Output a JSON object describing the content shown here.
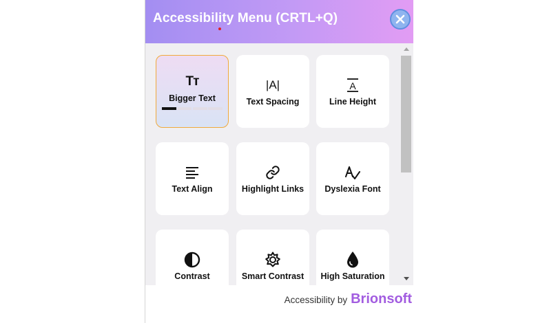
{
  "header": {
    "title": "Accessibility Menu (CRTL+Q)",
    "close_icon": "close-icon",
    "gradient_colors": [
      "#a38ef2",
      "#e29cf4"
    ]
  },
  "cards": [
    {
      "label": "Bigger Text",
      "icon": "text-size-icon",
      "icon_text": "Tт",
      "active": true,
      "level": 1,
      "levels": 4
    },
    {
      "label": "Text Spacing",
      "icon": "text-spacing-icon",
      "icon_text": "|A|"
    },
    {
      "label": "Line Height",
      "icon": "line-height-icon"
    },
    {
      "label": "Text Align",
      "icon": "text-align-icon"
    },
    {
      "label": "Highlight Links",
      "icon": "link-icon"
    },
    {
      "label": "Dyslexia Font",
      "icon": "dyslexia-font-icon"
    },
    {
      "label": "Contrast",
      "icon": "contrast-icon"
    },
    {
      "label": "Smart Contrast",
      "icon": "smart-contrast-icon"
    },
    {
      "label": "High Saturation",
      "icon": "saturation-drop-icon"
    }
  ],
  "footer": {
    "prefix": "Accessibility by",
    "brand": "Brionsoft",
    "brand_color": "#a25ce0"
  },
  "colors": {
    "active_border": "#f1a93a",
    "panel_background": "#f0eff2"
  }
}
